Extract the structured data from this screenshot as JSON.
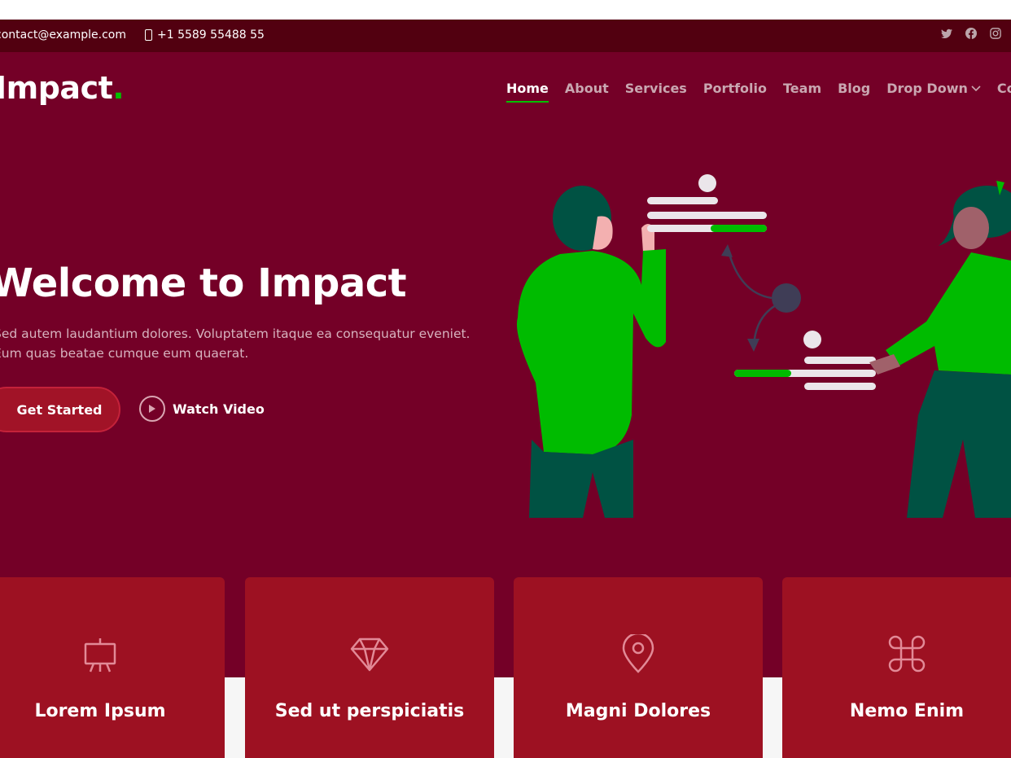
{
  "topbar": {
    "email": "contact@example.com",
    "phone": "+1 5589 55488 55",
    "socials": [
      "twitter-icon",
      "facebook-icon",
      "instagram-icon"
    ]
  },
  "header": {
    "logo_text": "Impact",
    "logo_dot": ".",
    "nav": [
      {
        "label": "Home",
        "active": true
      },
      {
        "label": "About"
      },
      {
        "label": "Services"
      },
      {
        "label": "Portfolio"
      },
      {
        "label": "Team"
      },
      {
        "label": "Blog"
      },
      {
        "label": "Drop Down"
      },
      {
        "label": "Contact"
      }
    ]
  },
  "hero": {
    "title": "Welcome to Impact",
    "text_line1": "Sed autem laudantium dolores. Voluptatem itaque ea consequatur eveniet.",
    "text_line2": "Eum quas beatae cumque eum quaerat.",
    "cta_label": "Get Started",
    "video_label": "Watch Video"
  },
  "cards": [
    {
      "title": "Lorem Ipsum",
      "icon": "easel-icon"
    },
    {
      "title": "Sed ut perspiciatis",
      "icon": "gem-icon"
    },
    {
      "title": "Magni Dolores",
      "icon": "geo-alt-icon"
    },
    {
      "title": "Nemo Enim",
      "icon": "command-icon"
    }
  ],
  "colors": {
    "topbar": "#520010",
    "hero": "#740027",
    "card": "#9d1122",
    "accent": "#00c000"
  }
}
